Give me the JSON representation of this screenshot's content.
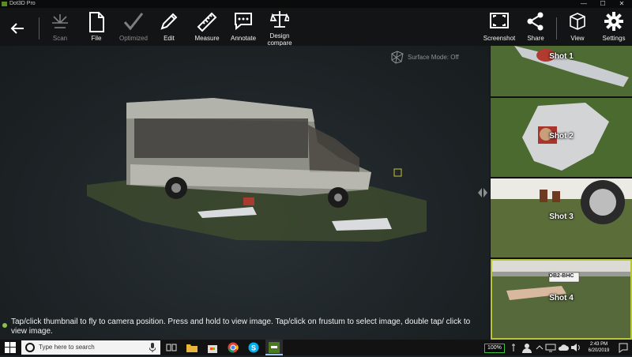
{
  "window": {
    "title": "Dot3D Pro",
    "controls": [
      "—",
      "☐",
      "✕"
    ]
  },
  "toolbar": {
    "back_icon": "arrow-left-icon",
    "left_items": [
      {
        "label": "Scan",
        "icon": "scan-icon",
        "enabled": false
      },
      {
        "label": "File",
        "icon": "file-icon",
        "enabled": true
      },
      {
        "label": "Optimized",
        "icon": "check-icon",
        "enabled": false
      },
      {
        "label": "Edit",
        "icon": "pencil-icon",
        "enabled": true
      },
      {
        "label": "Measure",
        "icon": "ruler-icon",
        "enabled": true
      },
      {
        "label": "Annotate",
        "icon": "comment-icon",
        "enabled": true
      },
      {
        "label": "Design compare",
        "icon": "compare-icon",
        "enabled": true
      }
    ],
    "right_items": [
      {
        "label": "Screenshot",
        "icon": "screenshot-icon"
      },
      {
        "label": "Share",
        "icon": "share-icon"
      },
      {
        "label": "View",
        "icon": "cube-view-icon"
      },
      {
        "label": "Settings",
        "icon": "gear-icon"
      }
    ]
  },
  "viewport": {
    "surface_mode": "Surface Mode: Off",
    "hint": "Tap/click thumbnail to fly to camera position. Press and hold to view image. Tap/click on frustum to select image, double tap/ click to view image."
  },
  "shots": [
    {
      "label": "Shot 1",
      "active": false
    },
    {
      "label": "Shot 2",
      "active": false
    },
    {
      "label": "Shot 3",
      "active": false
    },
    {
      "label": "Shot 4",
      "active": true
    }
  ],
  "shot4_plate": "OB2-BHC",
  "taskbar": {
    "search_placeholder": "Type here to search",
    "battery": "100%",
    "time": "2:43 PM",
    "date": "6/20/2019",
    "accent": "#3fbf3f"
  }
}
